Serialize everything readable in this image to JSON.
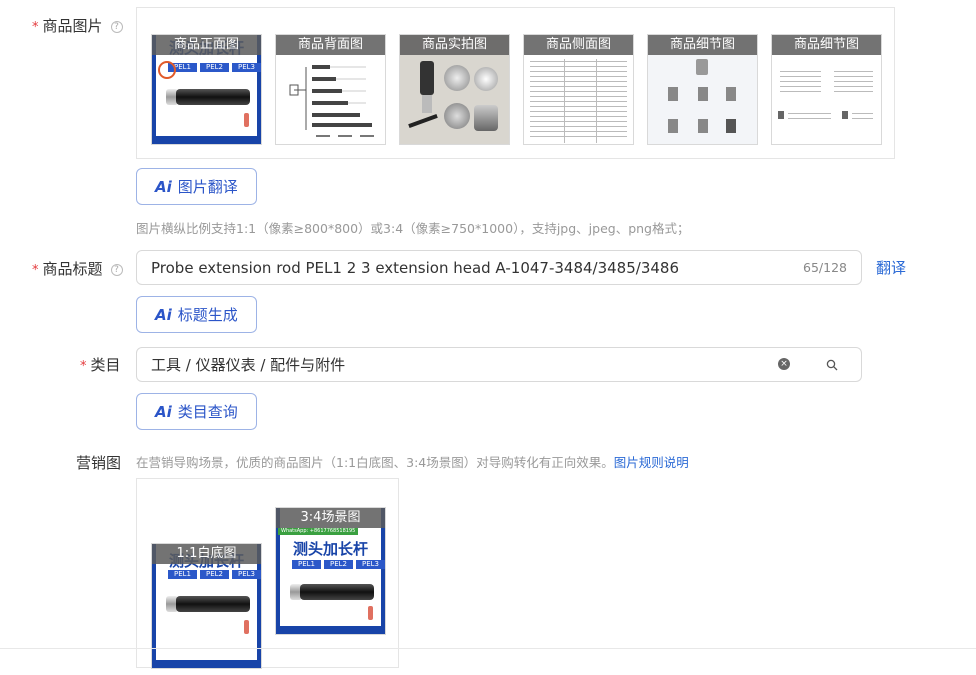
{
  "product_images": {
    "label": "商品图片",
    "thumbs": [
      {
        "caption": "商品正面图"
      },
      {
        "caption": "商品背面图"
      },
      {
        "caption": "商品实拍图"
      },
      {
        "caption": "商品侧面图"
      },
      {
        "caption": "商品细节图"
      },
      {
        "caption": "商品细节图"
      }
    ],
    "translate_btn": "图片翻译",
    "hint": "图片横纵比例支持1:1（像素≥800*800）或3:4（像素≥750*1000），支持jpg、jpeg、png格式；"
  },
  "product_title": {
    "label": "商品标题",
    "value": "Probe extension rod PEL1 2 3 extension head A-1047-3484/3485/3486",
    "counter": "65/128",
    "translate_link": "翻译",
    "generate_btn": "标题生成"
  },
  "category": {
    "label": "类目",
    "value": "工具 / 仪器仪表 / 配件与附件",
    "query_btn": "类目查询"
  },
  "marketing": {
    "label": "营销图",
    "hint": "在营销导购场景，优质的商品图片（1:1白底图、3:4场景图）对导购转化有正向效果。",
    "rules_link": "图片规则说明",
    "thumbs": [
      {
        "caption": "1:1白底图"
      },
      {
        "caption": "3:4场景图"
      }
    ]
  },
  "product_art": {
    "title": "测头加长杆",
    "tags": [
      "PEL1",
      "PEL2",
      "PEL3"
    ],
    "watermark": "WhatsApp: +8617768518195"
  },
  "ai_mark": "Ai",
  "colors": {
    "accent": "#2b55c8",
    "required": "#e4393c",
    "link": "#2b6ad6",
    "brand_blue": "#1844a8"
  }
}
